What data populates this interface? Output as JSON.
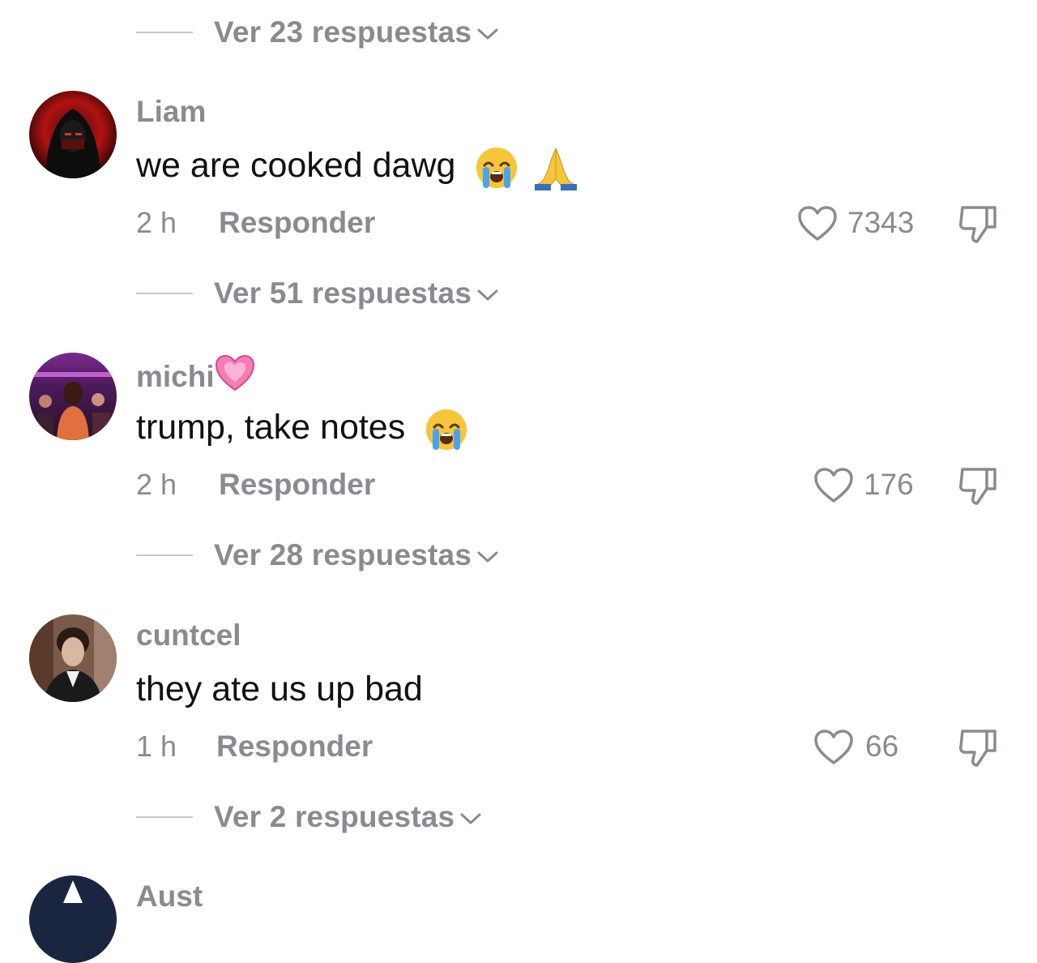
{
  "replies": [
    {
      "label": "Ver 23 respuestas"
    },
    {
      "label": "Ver 51 respuestas"
    },
    {
      "label": "Ver 28 respuestas"
    },
    {
      "label": "Ver 2 respuestas"
    }
  ],
  "comments": [
    {
      "username": "Liam",
      "text": "we are cooked dawg",
      "emojis": [
        "loudly-crying-face",
        "folded-hands"
      ],
      "time": "2 h",
      "reply_label": "Responder",
      "likes": "7343"
    },
    {
      "username": "michi",
      "username_emoji": "growing-heart",
      "text": "trump, take notes",
      "emojis": [
        "loudly-crying-face"
      ],
      "time": "2 h",
      "reply_label": "Responder",
      "likes": "176"
    },
    {
      "username": "cuntcel",
      "text": "they ate us up bad",
      "time": "1 h",
      "reply_label": "Responder",
      "likes": "66"
    },
    {
      "username": "Aust"
    }
  ],
  "colors": {
    "secondary_text": "#8a8b91",
    "primary_text": "#111111",
    "divider": "#c9c9cc"
  }
}
